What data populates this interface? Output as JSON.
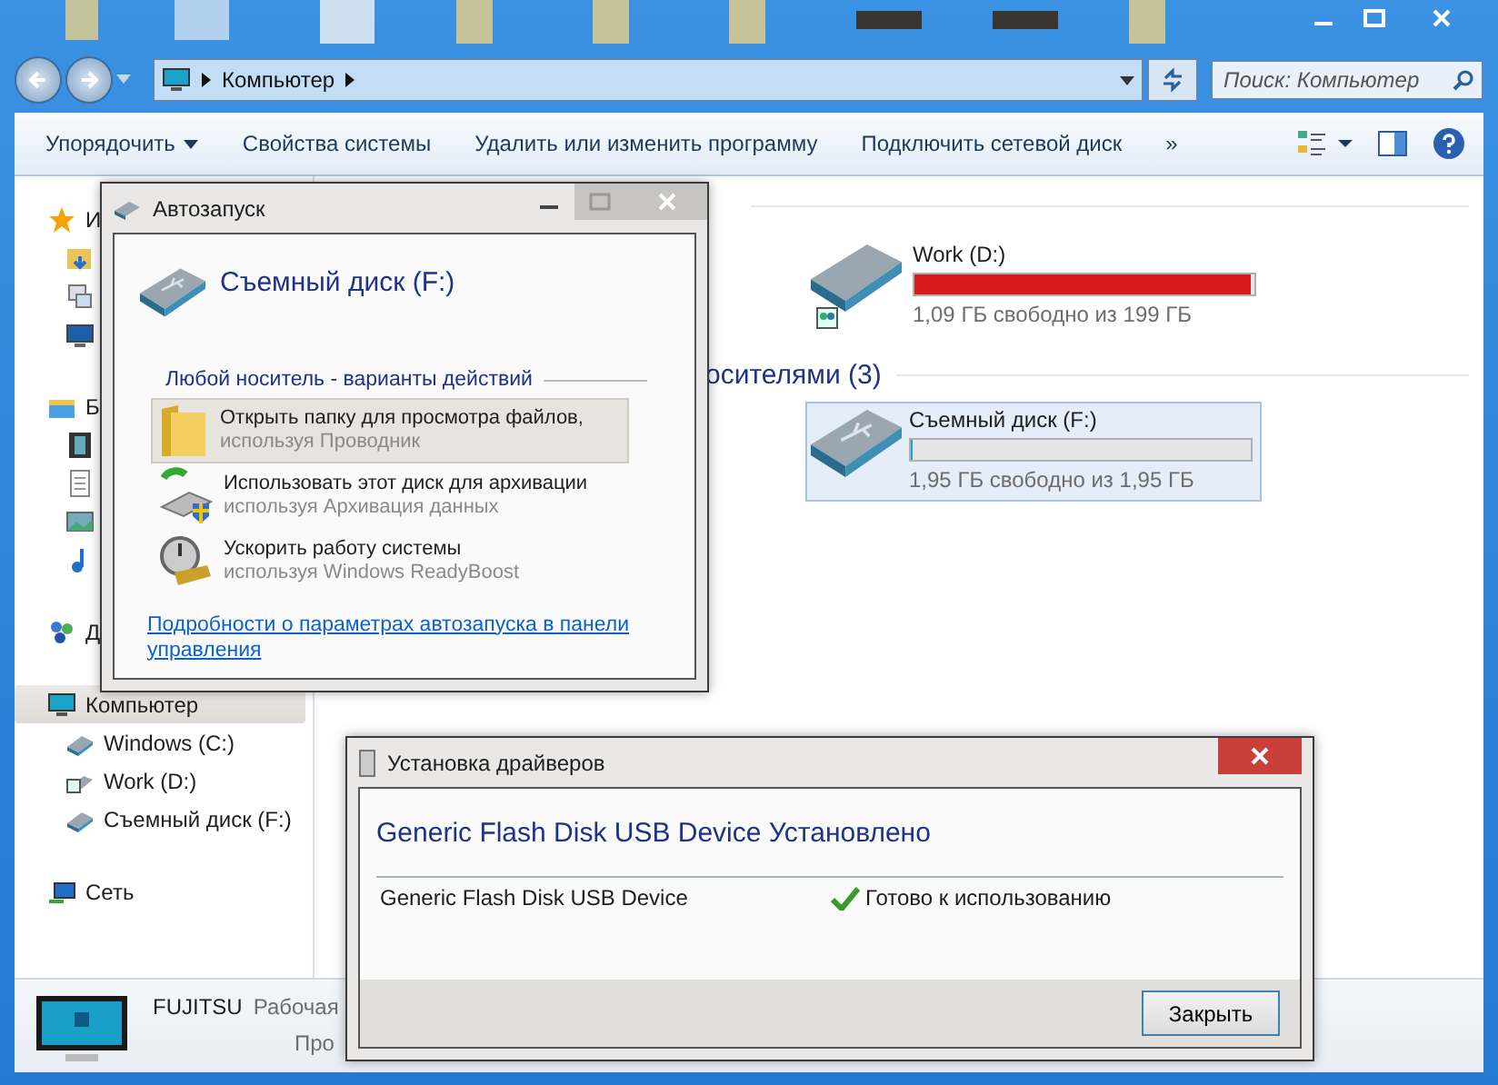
{
  "window": {
    "address": [
      "Компьютер"
    ],
    "search": {
      "placeholder": "Поиск: Компьютер"
    }
  },
  "toolbar": [
    {
      "label": "Упорядочить",
      "kind": "menu"
    },
    {
      "label": "Свойства системы",
      "kind": "button"
    },
    {
      "label": "Удалить или изменить программу",
      "kind": "button"
    },
    {
      "label": "Подключить сетевой диск",
      "kind": "button"
    },
    {
      "label": "»",
      "kind": "button"
    }
  ],
  "sidebar": {
    "groups": [
      {
        "label": "И",
        "kind": "star",
        "selected": false,
        "children": [
          {
            "kind": "download"
          },
          {
            "kind": "places"
          },
          {
            "kind": "desktop"
          }
        ]
      },
      {
        "label": "Б",
        "kind": "library",
        "selected": false,
        "children": [
          {
            "kind": "video"
          },
          {
            "kind": "document"
          },
          {
            "kind": "picture"
          },
          {
            "kind": "music"
          }
        ]
      },
      {
        "label": "Д",
        "kind": "homegroup",
        "selected": false
      },
      {
        "label": "Компьютер",
        "kind": "computer",
        "selected": true,
        "children": [
          {
            "kind": "drive",
            "label": "Windows (C:)"
          },
          {
            "kind": "shared-drive",
            "label": "Work (D:)"
          },
          {
            "kind": "drive",
            "label": "Съемный диск (F:)"
          }
        ]
      },
      {
        "label": "Сеть",
        "kind": "network",
        "selected": false
      }
    ]
  },
  "hard_drives": {
    "drives": [
      {
        "name": "Work (D:)",
        "kind": "shared-drive",
        "level": 0.99,
        "color": "#d71a1a",
        "caption": "1,09 ГБ свободно из 199 ГБ",
        "selected": false
      }
    ]
  },
  "removable": {
    "heading": "осителями (3)",
    "drives": [
      {
        "name": "Съемный диск (F:)",
        "kind": "usb-drive",
        "level": 0,
        "caption": "1,95 ГБ свободно из 1,95 ГБ",
        "selected": true
      }
    ]
  },
  "details": {
    "name": "FUJITSU",
    "lines": [
      "Рабочая",
      "Про"
    ]
  },
  "autoplay": {
    "title": "Автозапуск",
    "device": "Съемный диск (F:)",
    "section": "Любой носитель - варианты действий",
    "options": [
      {
        "kind": "folder",
        "title": "Открыть папку для просмотра файлов,",
        "subtitle": "используя Проводник",
        "selected": true
      },
      {
        "kind": "backup",
        "title": "Использовать этот диск для архивации",
        "subtitle": "используя Архивация данных",
        "selected": false
      },
      {
        "kind": "readyboost",
        "title": "Ускорить работу системы",
        "subtitle": "используя Windows ReadyBoost",
        "selected": false
      }
    ],
    "link": "Подробности о параметрах автозапуска в панели управления"
  },
  "driver_dialog": {
    "title": "Установка драйверов",
    "heading": "Generic Flash Disk USB Device Установлено",
    "devices": [
      {
        "name": "Generic Flash Disk USB Device",
        "status": "Готово к использованию"
      }
    ],
    "button": "Закрыть"
  }
}
